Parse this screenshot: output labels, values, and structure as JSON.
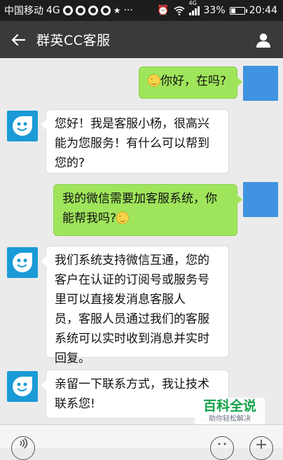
{
  "statusbar": {
    "carrier": "中国移动",
    "network": "4G",
    "signal_label": "4G",
    "battery_percent": "33%",
    "battery_level": 0.33,
    "time": "20:44",
    "more": "···"
  },
  "header": {
    "title": "群英CC客服"
  },
  "messages": [
    {
      "side": "right",
      "text": "你好，在吗?",
      "emoji": "smile-emoji"
    },
    {
      "side": "left",
      "line1": "您好！我是客服小杨，很高兴",
      "line2": "能为您服务！有什么可以帮到",
      "line3": "您的?"
    },
    {
      "side": "right",
      "line1": "我的微信需要加客服系统，你",
      "line2": "能帮我吗?",
      "emoji": "smile-emoji"
    },
    {
      "side": "left",
      "line1": "我们系统支持微信互通，您的",
      "line2": "客户在认证的订阅号或服务号",
      "line3": "里可以直接发消息客服人",
      "line4": "员，客服人员通过我们的客服",
      "line5": "系统可以实时收到消息并实时",
      "line6": "回复。"
    },
    {
      "side": "left",
      "line1": "亲留一下联系方式，我让技术",
      "line2": "联系您!"
    }
  ],
  "watermark": {
    "title": "百科全说",
    "subtitle": "助你轻松解决"
  },
  "colors": {
    "statusbar": "#1d1d1d",
    "titlebar": "#3a3a3a",
    "chat_bg": "#ebebeb",
    "bubble_mine": "#9fe55b",
    "bubble_other": "#ffffff",
    "avatar_bot": "#1a9ad6"
  }
}
